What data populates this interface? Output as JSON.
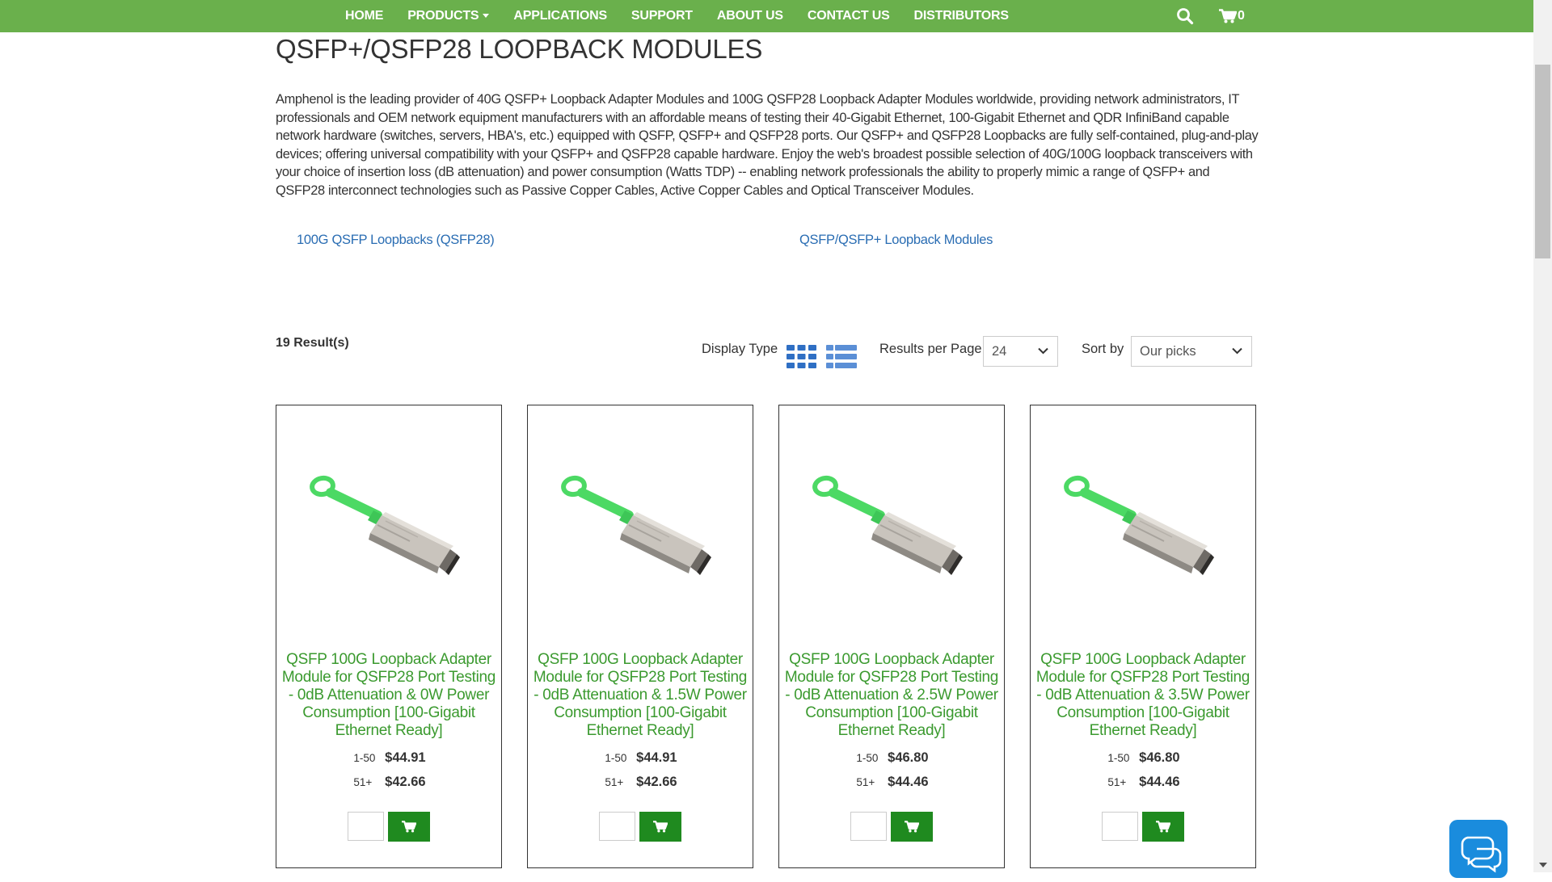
{
  "nav": {
    "items": [
      "HOME",
      "PRODUCTS",
      "APPLICATIONS",
      "SUPPORT",
      "ABOUT US",
      "CONTACT US",
      "DISTRIBUTORS"
    ],
    "cart_count": "0",
    "bg_color": "#6ab04c"
  },
  "page": {
    "title": "QSFP+/QSFP28 LOOPBACK MODULES",
    "intro": "Amphenol is the leading provider of 40G QSFP+ Loopback Adapter Modules and 100G QSFP28 Loopback Adapter Modules worldwide, providing network administrators, IT professionals and OEM network equipment manufacturers with an affordable means of testing their 40-Gigabit Ethernet, 100-Gigabit Ethernet and QDR InfiniBand capable network hardware (switches, servers, HBA's, etc.) equipped with QSFP, QSFP+ and QSFP28 ports.  Our QSFP+ and QSFP28 Loopbacks are fully self-contained, plug-and-play devices; offering universal compatibility with your QSFP+ and QSFP28 capable hardware.  Enjoy the web's broadest possible selection of 40G/100G loopback transceivers with your choice of insertion loss (dB attenuation) and power consumption (Watts TDP) -- enabling network professionals the ability to properly mimic a range of QSFP+ and QSFP28 interconnect technologies such as Passive Copper Cables, Active Copper Cables and Optical Transceiver Modules.",
    "category_links": [
      "100G QSFP Loopbacks (QSFP28)",
      "QSFP/QSFP+ Loopback Modules"
    ]
  },
  "toolbar": {
    "results": "19 Result(s)",
    "display_type_label": "Display Type",
    "results_per_page_label": "Results per Page",
    "results_per_page_value": "24",
    "sort_label": "Sort by",
    "sort_value": "Our picks"
  },
  "products": [
    {
      "title": "QSFP 100G Loopback Adapter Module for QSFP28 Port Testing - 0dB Attenuation & 0W Power Consumption [100-Gigabit Ethernet Ready]",
      "tiers": [
        {
          "qty": "1-50",
          "price": "$44.91"
        },
        {
          "qty": "51+",
          "price": "$42.66"
        }
      ]
    },
    {
      "title": "QSFP 100G Loopback Adapter Module for QSFP28 Port Testing - 0dB Attenuation & 1.5W Power Consumption [100-Gigabit Ethernet Ready]",
      "tiers": [
        {
          "qty": "1-50",
          "price": "$44.91"
        },
        {
          "qty": "51+",
          "price": "$42.66"
        }
      ]
    },
    {
      "title": "QSFP 100G Loopback Adapter Module for QSFP28 Port Testing - 0dB Attenuation & 2.5W Power Consumption [100-Gigabit Ethernet Ready]",
      "tiers": [
        {
          "qty": "1-50",
          "price": "$46.80"
        },
        {
          "qty": "51+",
          "price": "$44.46"
        }
      ]
    },
    {
      "title": "QSFP 100G Loopback Adapter Module for QSFP28 Port Testing - 0dB Attenuation & 3.5W Power Consumption [100-Gigabit Ethernet Ready]",
      "tiers": [
        {
          "qty": "1-50",
          "price": "$46.80"
        },
        {
          "qty": "51+",
          "price": "$44.46"
        }
      ]
    }
  ],
  "colors": {
    "product_title": "#3b9a2f",
    "link": "#2a6db3",
    "cart_button": "#1f8a1f",
    "view_icon": "#2f6fc4",
    "chat_widget": "#1a8cdd"
  },
  "icons": {
    "search": "search-icon",
    "cart": "cart-icon",
    "grid_view": "grid-view-icon",
    "list_view": "list-view-icon",
    "chat": "chat-icon",
    "add_to_cart": "cart-icon"
  }
}
